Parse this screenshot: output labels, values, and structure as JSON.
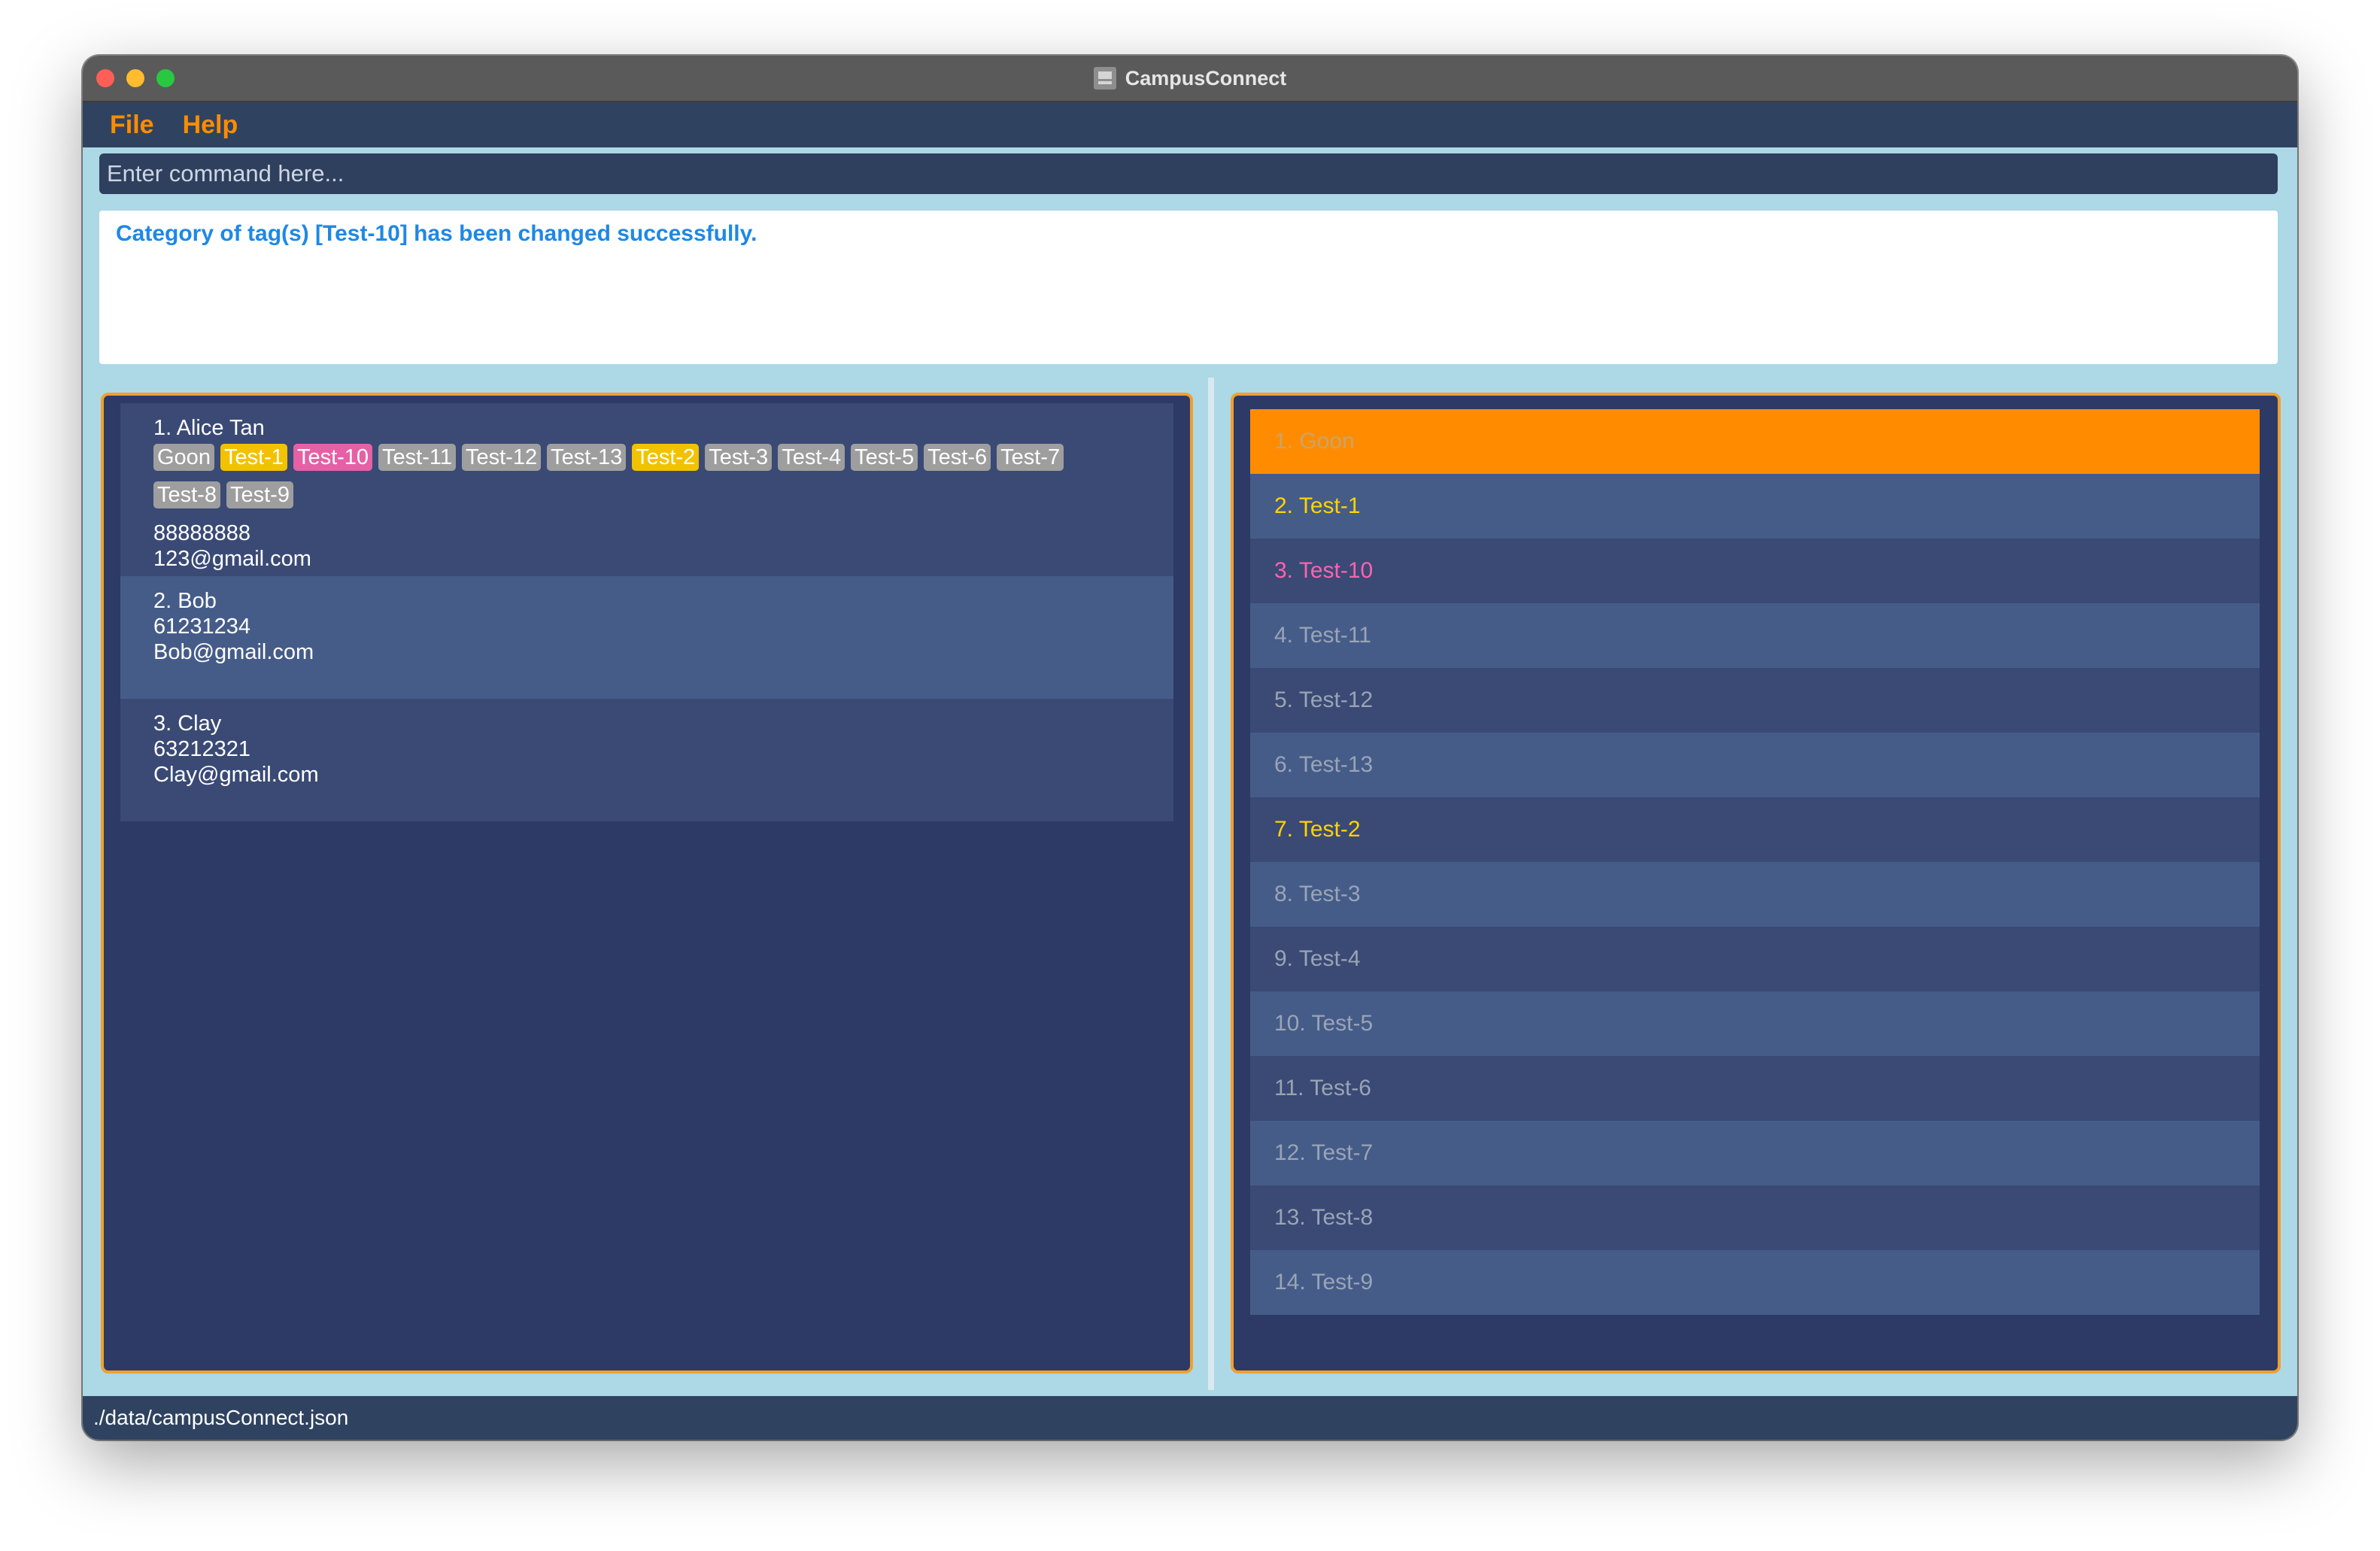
{
  "window": {
    "title": "CampusConnect"
  },
  "menu": {
    "file": "File",
    "help": "Help"
  },
  "command": {
    "placeholder": "Enter command here..."
  },
  "result": {
    "message": "Category of tag(s) [Test-10] has been changed successfully."
  },
  "persons": [
    {
      "header": "1. Alice Tan",
      "tags": [
        {
          "label": "Goon",
          "color": "#9e9e9e"
        },
        {
          "label": "Test-1",
          "color": "#f2c200"
        },
        {
          "label": "Test-10",
          "color": "#e660a6"
        },
        {
          "label": "Test-11",
          "color": "#9e9e9e"
        },
        {
          "label": "Test-12",
          "color": "#9e9e9e"
        },
        {
          "label": "Test-13",
          "color": "#9e9e9e"
        },
        {
          "label": "Test-2",
          "color": "#f2c200"
        },
        {
          "label": "Test-3",
          "color": "#9e9e9e"
        },
        {
          "label": "Test-4",
          "color": "#9e9e9e"
        },
        {
          "label": "Test-5",
          "color": "#9e9e9e"
        },
        {
          "label": "Test-6",
          "color": "#9e9e9e"
        },
        {
          "label": "Test-7",
          "color": "#9e9e9e"
        },
        {
          "label": "Test-8",
          "color": "#9e9e9e"
        },
        {
          "label": "Test-9",
          "color": "#9e9e9e"
        }
      ],
      "phone": "88888888",
      "email": "123@gmail.com"
    },
    {
      "header": "2. Bob",
      "phone": "61231234",
      "email": "Bob@gmail.com"
    },
    {
      "header": "3. Clay",
      "phone": "63212321",
      "email": "Clay@gmail.com"
    }
  ],
  "tag_list": [
    {
      "label": "1. Goon",
      "color": "#c9a46a",
      "selected": true
    },
    {
      "label": "2. Test-1",
      "color": "#ffd400"
    },
    {
      "label": "3. Test-10",
      "color": "#ff62b0"
    },
    {
      "label": "4. Test-11",
      "color": "#9aa4b5"
    },
    {
      "label": "5. Test-12",
      "color": "#9aa4b5"
    },
    {
      "label": "6. Test-13",
      "color": "#9aa4b5"
    },
    {
      "label": "7. Test-2",
      "color": "#ffd400"
    },
    {
      "label": "8. Test-3",
      "color": "#9aa4b5"
    },
    {
      "label": "9. Test-4",
      "color": "#9aa4b5"
    },
    {
      "label": "10. Test-5",
      "color": "#9aa4b5"
    },
    {
      "label": "11. Test-6",
      "color": "#9aa4b5"
    },
    {
      "label": "12. Test-7",
      "color": "#9aa4b5"
    },
    {
      "label": "13. Test-8",
      "color": "#9aa4b5"
    },
    {
      "label": "14. Test-9",
      "color": "#9aa4b5"
    }
  ],
  "status": {
    "path": "./data/campusConnect.json"
  }
}
